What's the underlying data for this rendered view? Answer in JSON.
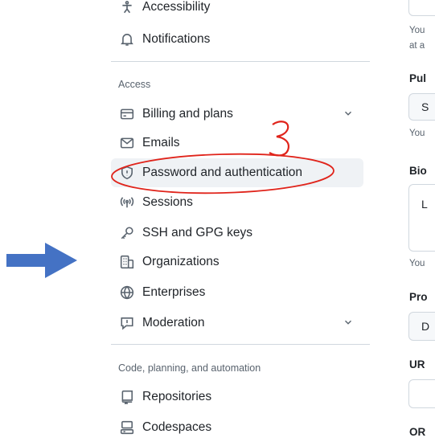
{
  "sidebar": {
    "items_top": [
      {
        "label": "Accessibility",
        "icon": "accessibility-icon"
      },
      {
        "label": "Notifications",
        "icon": "bell-icon"
      }
    ],
    "access_heading": "Access",
    "access_items": [
      {
        "label": "Billing and plans",
        "icon": "credit-card-icon",
        "has_chevron": true
      },
      {
        "label": "Emails",
        "icon": "mail-icon"
      },
      {
        "label": "Password and authentication",
        "icon": "shield-lock-icon",
        "active": true
      },
      {
        "label": "Sessions",
        "icon": "broadcast-icon"
      },
      {
        "label": "SSH and GPG keys",
        "icon": "key-icon"
      },
      {
        "label": "Organizations",
        "icon": "organization-icon"
      },
      {
        "label": "Enterprises",
        "icon": "globe-icon"
      },
      {
        "label": "Moderation",
        "icon": "report-icon",
        "has_chevron": true
      }
    ],
    "code_heading": "Code, planning, and automation",
    "code_items": [
      {
        "label": "Repositories",
        "icon": "repo-icon"
      },
      {
        "label": "Codespaces",
        "icon": "codespaces-icon"
      }
    ]
  },
  "right_panel": {
    "text_1": "You",
    "text_2": "at a",
    "label_public": "Pul",
    "field_public_value": "S",
    "text_3": "You",
    "label_bio": "Bio",
    "field_bio_value": "L",
    "text_4": "You",
    "label_pronouns": "Pro",
    "field_pronouns_value": "D",
    "label_url": "UR",
    "label_orcid": "OR"
  },
  "annotation": {
    "number": "3",
    "color": "#e0241b",
    "arrow_color": "#4472c4"
  }
}
